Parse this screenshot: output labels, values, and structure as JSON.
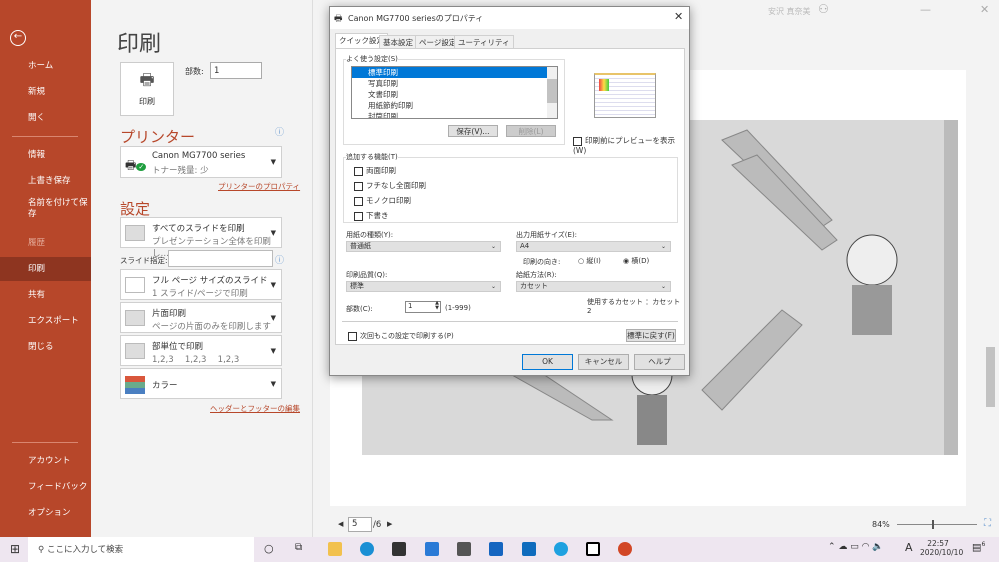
{
  "sidebar": {
    "items": [
      "ホーム",
      "新規",
      "開く",
      "情報",
      "上書き保存",
      "名前を付けて保存",
      "履歴",
      "印刷",
      "共有",
      "エクスポート",
      "閉じる",
      "アカウント",
      "フィードバック",
      "オプション"
    ],
    "selected": "印刷"
  },
  "title_bar": {
    "user": "安沢 真奈美"
  },
  "print": {
    "title": "印刷",
    "print_button": "印刷",
    "copies_label": "部数:",
    "copies_value": "1",
    "printer_heading": "プリンター",
    "printer_name": "Canon MG7700 series",
    "printer_status": "トナー残量: 少",
    "printer_properties_link": "プリンターのプロパティ",
    "settings_heading": "設定",
    "slides_l1": "すべてのスライドを印刷",
    "slides_l2": "プレゼンテーション全体を印刷し…",
    "slide_range_label": "スライド指定:",
    "slide_range_value": "",
    "layout_l1": "フル ページ サイズのスライド",
    "layout_l2": "1 スライド/ページで印刷",
    "sides_l1": "片面印刷",
    "sides_l2": "ページの片面のみを印刷します",
    "collate_l1": "部単位で印刷",
    "collate_l2": "1,2,3　 1,2,3　 1,2,3",
    "color_l1": "カラー",
    "header_footer_link": "ヘッダーとフッターの編集"
  },
  "preview": {
    "page_current": "5",
    "page_total": "/6",
    "zoom": "84%"
  },
  "dialog": {
    "title": "Canon MG7700 seriesのプロパティ",
    "tabs": [
      "クイック設定",
      "基本設定",
      "ページ設定",
      "ユーティリティ"
    ],
    "presets_label": "よく使う設定(S)",
    "presets": [
      "標準印刷",
      "写真印刷",
      "文書印刷",
      "用紙節約印刷",
      "封筒印刷"
    ],
    "save_button": "保存(V)...",
    "delete_button": "削除(L)",
    "preview_checkbox": "印刷前にプレビューを表示(W)",
    "features_label": "追加する機能(T)",
    "features": [
      "両面印刷",
      "フチなし全面印刷",
      "モノクロ印刷",
      "下書き"
    ],
    "media_type_label": "用紙の種類(Y):",
    "media_type": "普通紙",
    "paper_size_label": "出力用紙サイズ(E):",
    "paper_size": "A4",
    "orientation_label": "印刷の向き:",
    "orientation_portrait": "縦(I)",
    "orientation_landscape": "横(D)",
    "orientation_selected": "横(D)",
    "quality_label": "印刷品質(Q):",
    "quality": "標準",
    "source_label": "給紙方法(R):",
    "source": "カセット",
    "cassette_info": "使用するカセット ：カセット2",
    "copies_label": "部数(C):",
    "copies_value": "1",
    "copies_range": "(1-999)",
    "always_checkbox": "次回もこの設定で印刷する(P)",
    "defaults_button": "標準に戻す(F)",
    "ok": "OK",
    "cancel": "キャンセル",
    "help": "ヘルプ"
  },
  "taskbar": {
    "search_placeholder": "ここに入力して検索",
    "time": "22:57",
    "date": "2020/10/10",
    "notifications": "6",
    "ime": "A"
  }
}
